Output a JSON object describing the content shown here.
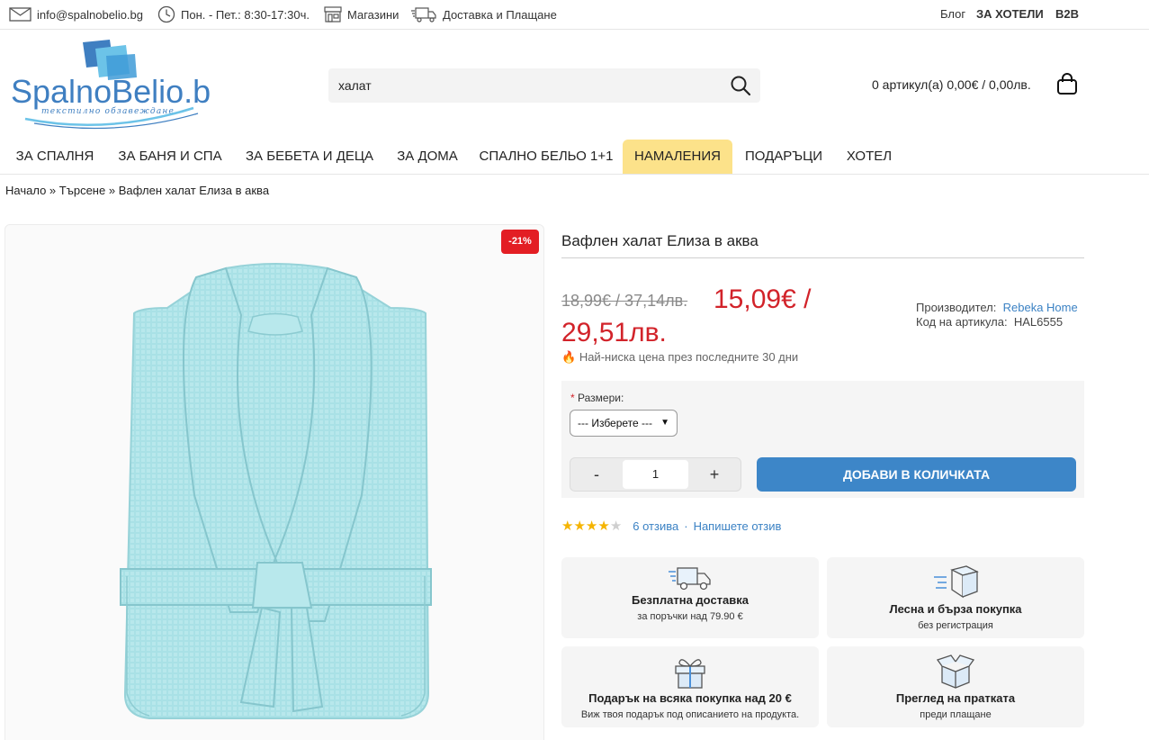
{
  "topbar": {
    "email": "info@spalnobelio.bg",
    "hours": "Пон. - Пет.: 8:30-17:30ч.",
    "stores": "Магазини",
    "delivery": "Доставка и Плащане",
    "blog": "Блог",
    "hotels": "ЗА ХОТЕЛИ",
    "b2b": "B2B"
  },
  "logo": {
    "brand": "SpalnoBelio.bg",
    "tagline": "текстилно обзавеждане"
  },
  "search": {
    "value": "халат"
  },
  "cart": {
    "summary": "0 артикул(а) 0,00€ / 0,00лв."
  },
  "nav": [
    "ЗА СПАЛНЯ",
    "ЗА БАНЯ И СПА",
    "ЗА БЕБЕТА И ДЕЦА",
    "ЗА ДОМА",
    "СПАЛНО БЕЛЬО 1+1",
    "НАМАЛЕНИЯ",
    "ПОДАРЪЦИ",
    "ХОТЕЛ"
  ],
  "breadcrumb": {
    "home": "Начало",
    "search": "Търсене",
    "current": "Вафлен халат Елиза в аква",
    "sep": "»"
  },
  "product": {
    "discount_badge": "-21%",
    "title": "Вафлен халат Елиза в аква",
    "old_price": "18,99€ / 37,14лв.",
    "new_price_line1": "15,09€ /",
    "new_price_line2": "29,51лв.",
    "lowest_price_note": "Най-ниска цена през последните 30 дни",
    "manufacturer_label": "Производител:",
    "manufacturer": "Rebeka Home",
    "sku_label": "Код на артикула:",
    "sku": "HAL6555",
    "size_label": "Размери:",
    "size_required": "*",
    "size_selected": "--- Изберете ---",
    "qty_minus": "-",
    "qty_value": "1",
    "qty_plus": "+",
    "add_to_cart": "ДОБАВИ В КОЛИЧКАТА",
    "rating_value": 4,
    "rating_max": 5,
    "reviews": "6 отзива",
    "write_review": "Напишете отзив",
    "rating_sep": "·"
  },
  "features": [
    {
      "title": "Безплатна доставка",
      "sub": "за поръчки над 79.90 €",
      "icon": "truck-icon"
    },
    {
      "title": "Лесна и бърза покупка",
      "sub": "без регистрация",
      "icon": "fast-box-icon"
    },
    {
      "title": "Подарък на всяка покупка над 20 €",
      "sub": "Виж твоя подарък под описанието на продукта.",
      "icon": "gift-icon"
    },
    {
      "title": "Преглед на пратката",
      "sub": "преди плащане",
      "icon": "open-box-icon"
    }
  ],
  "colors": {
    "accent_blue": "#3d86c8",
    "sale_yellow": "#fce28a",
    "price_red": "#d2232a",
    "robe": "#a9e1e6"
  }
}
